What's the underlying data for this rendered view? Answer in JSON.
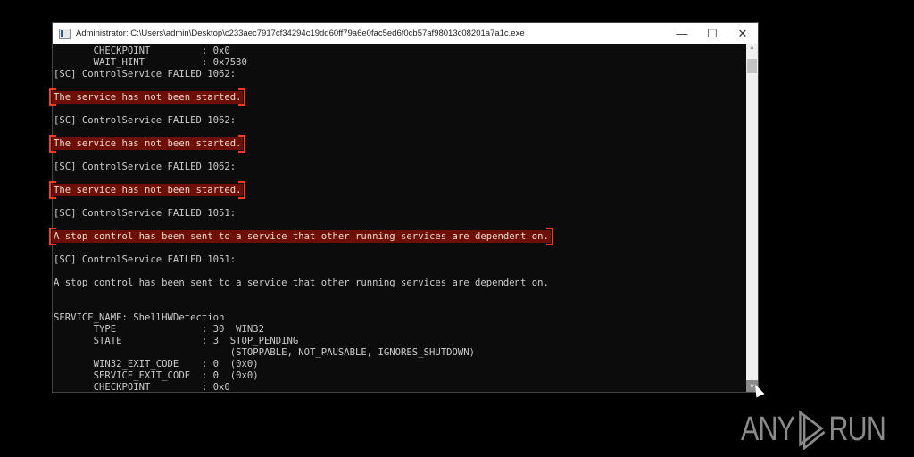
{
  "window": {
    "title": "Administrator: C:\\Users\\admin\\Desktop\\c233aec7917cf34294c19dd60ff79a6e0fac5ed6f0cb57af98013c08201a7a1c.exe",
    "minimize": "—",
    "maximize": "☐",
    "close": "✕"
  },
  "console": {
    "lines": [
      {
        "text": "       CHECKPOINT         : 0x0"
      },
      {
        "text": "       WAIT_HINT          : 0x7530"
      },
      {
        "text": "[SC] ControlService FAILED 1062:"
      },
      {
        "text": ""
      },
      {
        "text": "The service has not been started.",
        "highlight": true
      },
      {
        "text": ""
      },
      {
        "text": "[SC] ControlService FAILED 1062:"
      },
      {
        "text": ""
      },
      {
        "text": "The service has not been started.",
        "highlight": true
      },
      {
        "text": ""
      },
      {
        "text": "[SC] ControlService FAILED 1062:"
      },
      {
        "text": ""
      },
      {
        "text": "The service has not been started.",
        "highlight": true
      },
      {
        "text": ""
      },
      {
        "text": "[SC] ControlService FAILED 1051:"
      },
      {
        "text": ""
      },
      {
        "text": "A stop control has been sent to a service that other running services are dependent on.",
        "highlight": true
      },
      {
        "text": ""
      },
      {
        "text": "[SC] ControlService FAILED 1051:"
      },
      {
        "text": ""
      },
      {
        "text": "A stop control has been sent to a service that other running services are dependent on."
      },
      {
        "text": ""
      },
      {
        "text": ""
      },
      {
        "text": "SERVICE_NAME: ShellHWDetection"
      },
      {
        "text": "       TYPE               : 30  WIN32"
      },
      {
        "text": "       STATE              : 3  STOP_PENDING"
      },
      {
        "text": "                               (STOPPABLE, NOT_PAUSABLE, IGNORES_SHUTDOWN)"
      },
      {
        "text": "       WIN32_EXIT_CODE    : 0  (0x0)"
      },
      {
        "text": "       SERVICE_EXIT_CODE  : 0  (0x0)"
      },
      {
        "text": "       CHECKPOINT         : 0x0"
      }
    ]
  },
  "scrollbar": {
    "up": "^",
    "down": "v"
  },
  "watermark": {
    "left": "ANY",
    "right": "RUN"
  }
}
